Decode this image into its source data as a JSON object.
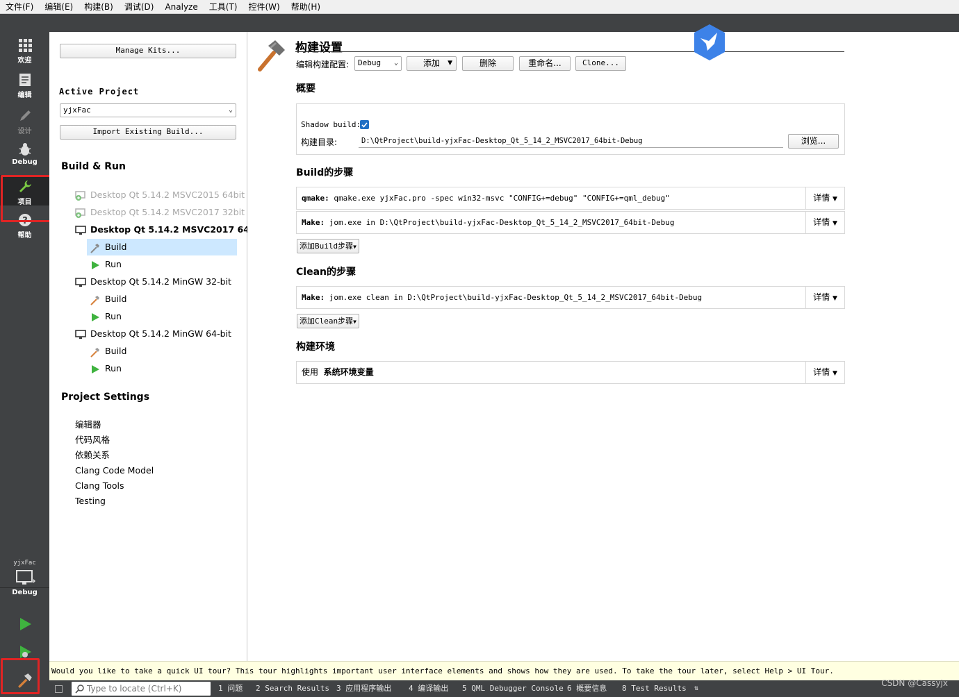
{
  "menu": [
    "文件(F)",
    "编辑(E)",
    "构建(B)",
    "调试(D)",
    "Analyze",
    "工具(T)",
    "控件(W)",
    "帮助(H)"
  ],
  "modes": {
    "welcome": "欢迎",
    "edit": "编辑",
    "design": "设计",
    "debug": "Debug",
    "projects": "项目",
    "help": "帮助"
  },
  "kit_selector": {
    "project": "yjxFac",
    "mode": "Debug"
  },
  "sidebar": {
    "manage_kits": "Manage Kits...",
    "active_project_title": "Active Project",
    "active_project_value": "yjxFac",
    "import_existing_build": "Import Existing Build...",
    "build_run_title": "Build & Run",
    "kits": [
      {
        "name": "Desktop Qt 5.14.2 MSVC2015 64bit",
        "state": "disabled"
      },
      {
        "name": "Desktop Qt 5.14.2 MSVC2017 32bit",
        "state": "disabled"
      },
      {
        "name": "Desktop Qt 5.14.2 MSVC2017 64...",
        "state": "active"
      },
      {
        "name": "Desktop Qt 5.14.2 MinGW 32-bit",
        "state": "normal"
      },
      {
        "name": "Desktop Qt 5.14.2 MinGW 64-bit",
        "state": "normal"
      }
    ],
    "build_label": "Build",
    "run_label": "Run",
    "project_settings_title": "Project Settings",
    "settings_items": [
      "编辑器",
      "代码风格",
      "依赖关系",
      "Clang Code Model",
      "Clang Tools",
      "Testing"
    ]
  },
  "main": {
    "title": "构建设置",
    "edit_config_label": "编辑构建配置:",
    "config_value": "Debug",
    "add_button": "添加",
    "delete_button": "删除",
    "rename_button": "重命名...",
    "clone_button": "Clone...",
    "overview_heading": "概要",
    "shadow_build_label": "Shadow build:",
    "shadow_build_checked": true,
    "build_dir_label": "构建目录:",
    "build_dir_value": "D:\\QtProject\\build-yjxFac-Desktop_Qt_5_14_2_MSVC2017_64bit-Debug",
    "browse_button": "浏览...",
    "build_steps_heading": "Build的步骤",
    "build_steps": [
      {
        "tool": "qmake:",
        "command": "qmake.exe yjxFac.pro -spec win32-msvc \"CONFIG+=debug\" \"CONFIG+=qml_debug\""
      },
      {
        "tool": "Make:",
        "command": "jom.exe in D:\\QtProject\\build-yjxFac-Desktop_Qt_5_14_2_MSVC2017_64bit-Debug"
      }
    ],
    "details_label": "详情",
    "add_build_step": "添加Build步骤",
    "clean_steps_heading": "Clean的步骤",
    "clean_steps": [
      {
        "tool": "Make:",
        "command": "jom.exe clean in D:\\QtProject\\build-yjxFac-Desktop_Qt_5_14_2_MSVC2017_64bit-Debug"
      }
    ],
    "add_clean_step": "添加Clean步骤",
    "build_env_heading": "构建环境",
    "build_env_prefix": "使用",
    "build_env_value": "系统环境变量"
  },
  "tour_banner": "Would you like to take a quick UI tour? This tour highlights important user interface elements and shows how they are used. To take the tour later, select Help > UI Tour.",
  "statusbar": {
    "locate_placeholder": "Type to locate (Ctrl+K)",
    "tabs": [
      "1 问题",
      "2 Search Results",
      "3 应用程序输出",
      "4 编译输出",
      "5 QML Debugger Console",
      "6 概要信息",
      "8 Test Results"
    ]
  },
  "watermark": "CSDN @Cassyjx",
  "colors": {
    "highlight_red": "#e02424",
    "selection": "#cde8ff",
    "modebar": "#404244",
    "run_green": "#3fb33f",
    "checkbox_blue": "#1f6fc5"
  }
}
